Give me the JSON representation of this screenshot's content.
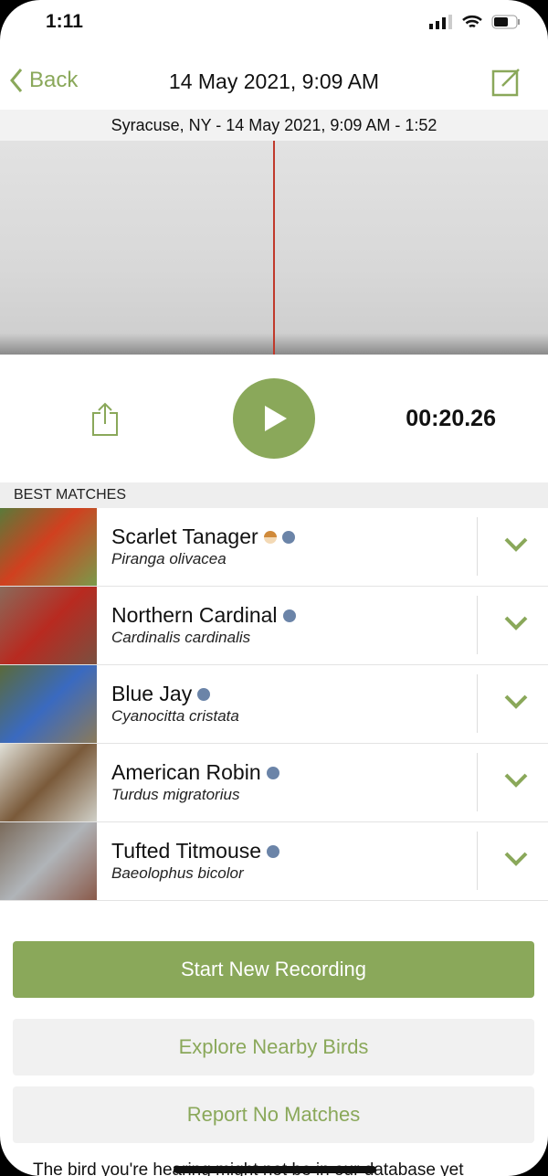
{
  "status": {
    "time": "1:11"
  },
  "nav": {
    "back": "Back",
    "title": "14 May 2021, 9:09 AM"
  },
  "recording": {
    "info": "Syracuse, NY - 14 May 2021, 9:09 AM - 1:52",
    "elapsed": "00:20.26"
  },
  "section": "BEST MATCHES",
  "matches": [
    {
      "name": "Scarlet Tanager",
      "sci": "Piranga olivacea",
      "rare": true
    },
    {
      "name": "Northern Cardinal",
      "sci": "Cardinalis cardinalis"
    },
    {
      "name": "Blue Jay",
      "sci": "Cyanocitta cristata"
    },
    {
      "name": "American Robin",
      "sci": "Turdus migratorius"
    },
    {
      "name": "Tufted Titmouse",
      "sci": "Baeolophus bicolor"
    }
  ],
  "buttons": {
    "start": "Start New Recording",
    "explore": "Explore Nearby Birds",
    "report": "Report No Matches"
  },
  "footer": "The bird you're hearing might not be in our database yet",
  "colors": {
    "accent": "#8aa85a",
    "cursor": "#c0392b",
    "verified": "#6b84a8",
    "rare": "#d08a3a"
  }
}
